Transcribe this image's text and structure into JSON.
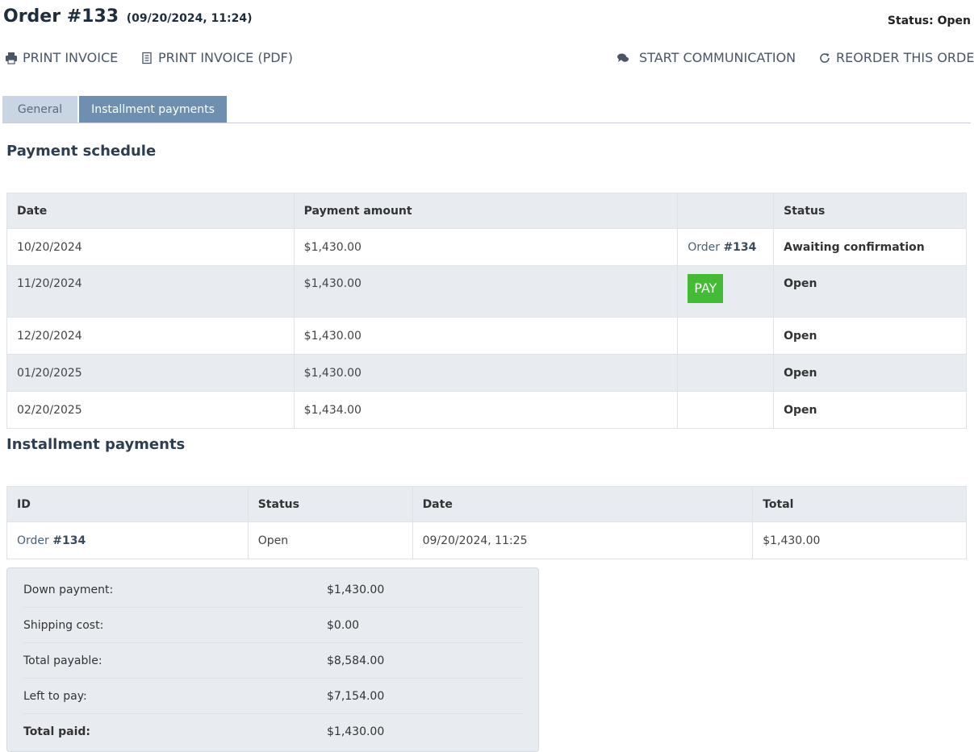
{
  "header": {
    "order_title": "Order #133",
    "order_date": "(09/20/2024, 11:24)",
    "status": "Status: Open"
  },
  "actions": {
    "print_invoice": "PRINT INVOICE",
    "print_invoice_pdf": "PRINT INVOICE (PDF)",
    "start_communication": "START COMMUNICATION",
    "reorder": "REORDER THIS ORDER"
  },
  "tabs": {
    "general": "General",
    "installments": "Installment payments"
  },
  "schedule": {
    "title": "Payment schedule",
    "headers": {
      "date": "Date",
      "amount": "Payment amount",
      "action": "",
      "status": "Status"
    },
    "rows": [
      {
        "date": "10/20/2024",
        "amount": "$1,430.00",
        "order_prefix": "Order ",
        "order_num": "#134",
        "status": "Awaiting confirmation"
      },
      {
        "date": "11/20/2024",
        "amount": "$1,430.00",
        "pay": "PAY",
        "status": "Open"
      },
      {
        "date": "12/20/2024",
        "amount": "$1,430.00",
        "status": "Open"
      },
      {
        "date": "01/20/2025",
        "amount": "$1,430.00",
        "status": "Open"
      },
      {
        "date": "02/20/2025",
        "amount": "$1,434.00",
        "status": "Open"
      }
    ]
  },
  "installments": {
    "title": "Installment payments",
    "headers": {
      "id": "ID",
      "status": "Status",
      "date": "Date",
      "total": "Total"
    },
    "rows": [
      {
        "id_prefix": "Order ",
        "id_num": "#134",
        "status": "Open",
        "date": "09/20/2024, 11:25",
        "total": "$1,430.00"
      }
    ]
  },
  "summary": {
    "down_payment_label": "Down payment:",
    "down_payment": "$1,430.00",
    "shipping_label": "Shipping cost:",
    "shipping": "$0.00",
    "total_payable_label": "Total payable:",
    "total_payable": "$8,584.00",
    "left_label": "Left to pay:",
    "left": "$7,154.00",
    "paid_label": "Total paid:",
    "paid": "$1,430.00"
  },
  "colors": {
    "pay_button": "#44bb35",
    "active_tab": "#6f8fb0",
    "inactive_tab": "#c8d6e4",
    "row_alt": "#e8ebf0"
  }
}
